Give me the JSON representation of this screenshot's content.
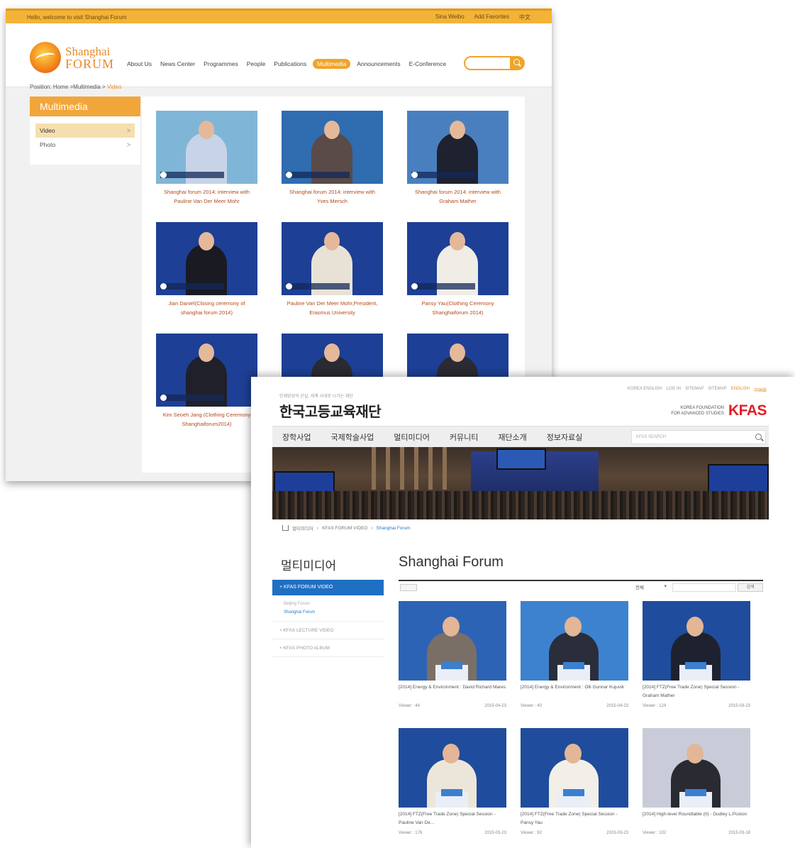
{
  "shanghai": {
    "topbar": {
      "welcome": "Hello, welcome to visit Shanghai Forum",
      "links": [
        "Sina Weibo",
        "Add Favorites",
        "中文"
      ]
    },
    "logo": {
      "line1": "Shanghai",
      "line2": "FORUM"
    },
    "nav": [
      "About Us",
      "News Center",
      "Programmes",
      "People",
      "Publications",
      "Multimedia",
      "Announcements",
      "E-Conference"
    ],
    "active_nav": "Multimedia",
    "breadcrumb": {
      "label": "Position:",
      "path": "Home >Multimedia >",
      "current": "Video"
    },
    "sidebar": {
      "title": "Multimedia",
      "items": [
        {
          "label": "Video",
          "arrow": ">"
        },
        {
          "label": "Photo",
          "arrow": ">"
        }
      ]
    },
    "videos": [
      {
        "caption": "Shanghai forum 2014: interview with Pauline Van Der Meer Mohr",
        "thumb": "#7fb6d8",
        "suit": "#c7d3e6"
      },
      {
        "caption": "Shanghai forum 2014: interview with Yves Mersch",
        "thumb": "#2f6cb0",
        "suit": "#5a4a48"
      },
      {
        "caption": "Shanghai forum 2014: interview with Graham Mather",
        "thumb": "#4a7fbf",
        "suit": "#1e2230"
      },
      {
        "caption": "Jian Daniel(Closing ceremony of shanghai forum 2014)",
        "thumb": "#1d3f95",
        "suit": "#1a1a22"
      },
      {
        "caption": "Pauline Van Der Meer Mohr,President, Erasmus University",
        "thumb": "#1d3f95",
        "suit": "#e8e2d6"
      },
      {
        "caption": "Pansy Yau(Clothing Ceremony Shanghaiforum 2014)",
        "thumb": "#1d3f95",
        "suit": "#f0ece6"
      },
      {
        "caption": "Kim Seoeh Jang (Clothing Ceremony Shanghaiforum2014)",
        "thumb": "#1d3f95",
        "suit": "#20202a"
      },
      {
        "caption": "",
        "thumb": "#1d3f95",
        "suit": "#2a2a33"
      },
      {
        "caption": "",
        "thumb": "#1d3f95",
        "suit": "#2a2a33"
      }
    ]
  },
  "kfas": {
    "util_links": [
      "KOREA ENGLISH",
      "LOG IN",
      "SITEMAP",
      "SITEMAP",
      "ENGLISH",
      "中国語"
    ],
    "tagline": "인재양성의 산실, 세계 시대로 나가는 재단",
    "brand": "한국고등교육재단",
    "logo_small_1": "KOREA FOUNDATION",
    "logo_small_2": "FOR ADVANCED STUDIES",
    "logo_big": "KFAS",
    "nav": [
      "장학사업",
      "국제학술사업",
      "멀티미디어",
      "커뮤니티",
      "재단소개",
      "정보자료실"
    ],
    "search_placeholder": "KFAS SEARCH",
    "breadcrumb": [
      "멀티미디어",
      "KFAS FORUM VIDEO",
      "Shanghai Forum"
    ],
    "side_title": "멀티미디어",
    "side_active": "+ KFAS FORUM VIDEO",
    "side_sub": [
      "Beijing Forum",
      "Shanghai Forum"
    ],
    "side_items": [
      "+ KFAS LECTURE VIDEO",
      "+ KFAS PHOTO ALBUM"
    ],
    "main_title": "Shanghai Forum",
    "filter_label": "전체",
    "search_button": "검색",
    "videos": [
      {
        "title": "[2014] Energy & Environment : David Richard Mares",
        "viewer": "Viewer : 44",
        "date": "2015-04-23",
        "thumb": "#2c63b5",
        "suit": "#7a6f66"
      },
      {
        "title": "[2014] Energy & Environment : Olli Gunnar Kujuvik",
        "viewer": "Viewer : 40",
        "date": "2015-04-23",
        "thumb": "#3d82cf",
        "suit": "#2a2e3a"
      },
      {
        "title": "[2014] FTZ(Free Trade Zone) Special Session - Graham Mather",
        "viewer": "Viewer : 124",
        "date": "2015-03-23",
        "thumb": "#1f4c9c",
        "suit": "#1e2230"
      },
      {
        "title": "[2014] FTZ(Free Trade Zone) Special Session - Pauline Van De...",
        "viewer": "Viewer : 176",
        "date": "2015-03-23",
        "thumb": "#1f4c9c",
        "suit": "#ece6da"
      },
      {
        "title": "[2014] FTZ(Free Trade Zone) Special Session - Pansy Yau",
        "viewer": "Viewer : 92",
        "date": "2015-03-23",
        "thumb": "#1f4c9c",
        "suit": "#f2eee8"
      },
      {
        "title": "[2014] High-level Roundtable (II) - Dudley L.Poston",
        "viewer": "Viewer : 102",
        "date": "2015-03-18",
        "thumb": "#c9ccd8",
        "suit": "#2a2a33"
      }
    ]
  }
}
